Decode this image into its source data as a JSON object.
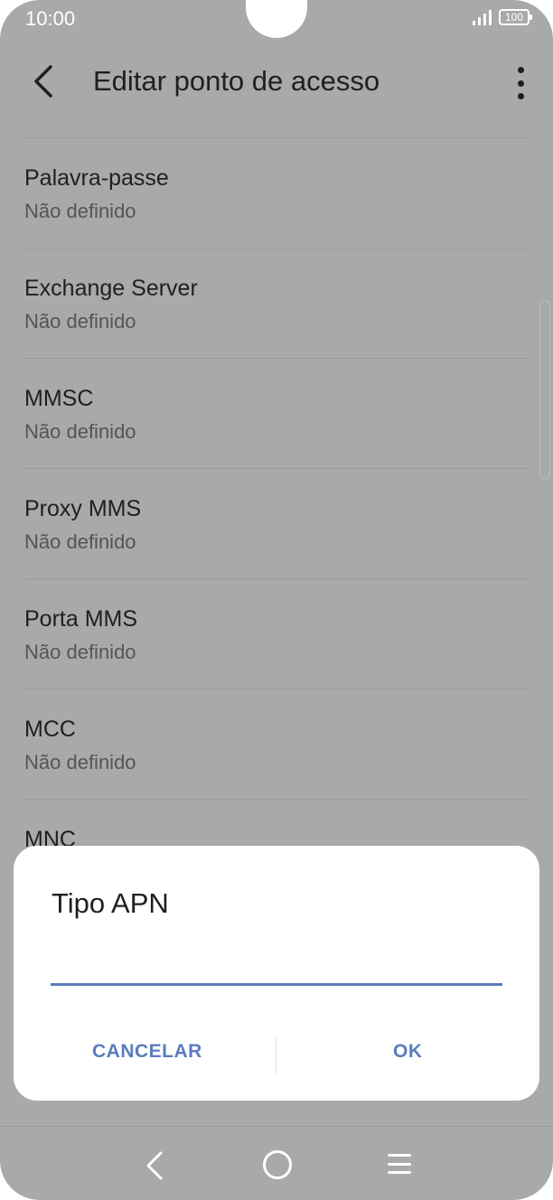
{
  "status_bar": {
    "time": "10:00",
    "battery": "100"
  },
  "header": {
    "title": "Editar ponto de acesso",
    "back_icon": "chevron-left-icon",
    "more_icon": "more-vertical-icon"
  },
  "settings": [
    {
      "title": "Palavra-passe",
      "value": "Não definido"
    },
    {
      "title": "Exchange Server",
      "value": "Não definido"
    },
    {
      "title": "MMSC",
      "value": "Não definido"
    },
    {
      "title": "Proxy MMS",
      "value": "Não definido"
    },
    {
      "title": "Porta MMS",
      "value": "Não definido"
    },
    {
      "title": "MCC",
      "value": "Não definido"
    },
    {
      "title": "MNC",
      "value": ""
    }
  ],
  "dialog": {
    "title": "Tipo APN",
    "input_value": "",
    "cancel_label": "CANCELAR",
    "ok_label": "OK",
    "accent_color": "#5b7dbd"
  },
  "nav_bar": {
    "back_icon": "back-icon",
    "home_icon": "home-icon",
    "menu_icon": "menu-icon"
  }
}
